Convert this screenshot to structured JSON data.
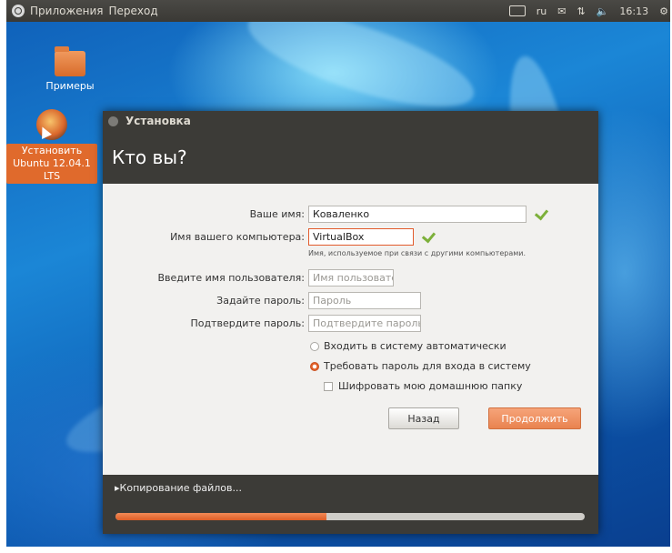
{
  "top_panel": {
    "menu_applications": "Приложения",
    "menu_places": "Переход",
    "keyboard_layout": "ru",
    "clock": "16:13"
  },
  "desktop": {
    "icons": [
      {
        "label": "Примеры",
        "icon": "folder-icon"
      },
      {
        "label": "Установить Ubuntu 12.04.1 LTS",
        "icon": "installer-icon"
      }
    ]
  },
  "window": {
    "title": "Установка",
    "heading": "Кто вы?",
    "fields": {
      "name_label": "Ваше имя:",
      "name_value": "Коваленко",
      "computer_label": "Имя вашего компьютера:",
      "computer_value": "VirtualBox",
      "computer_hint": "Имя, используемое при связи с другими компьютерами.",
      "username_label": "Введите имя пользователя:",
      "username_placeholder": "Имя пользователя",
      "password_label": "Задайте пароль:",
      "password_placeholder": "Пароль",
      "confirm_label": "Подтвердите пароль:",
      "confirm_placeholder": "Подтвердите пароль"
    },
    "options": {
      "auto_login": "Входить в систему автоматически",
      "require_password": "Требовать пароль для входа в систему",
      "encrypt_home": "Шифровать мою домашнюю папку",
      "selected": "require_password",
      "encrypt_checked": false
    },
    "buttons": {
      "back": "Назад",
      "next": "Продолжить"
    },
    "progress": {
      "label": "Копирование файлов...",
      "fraction": 0.45
    }
  },
  "colors": {
    "accent": "#e9834f",
    "panel": "#3c3b37",
    "desktop": "#1b86d6",
    "check": "#7db03a"
  }
}
